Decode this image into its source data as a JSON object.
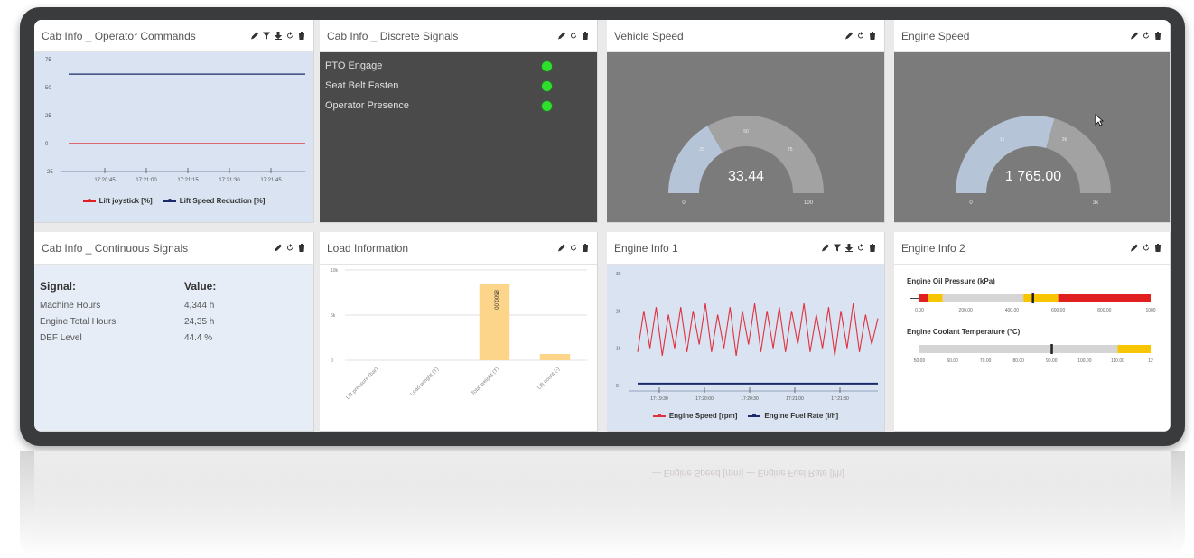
{
  "panels": {
    "operator_commands": {
      "title": "Cab Info _ Operator Commands",
      "chart_data": {
        "type": "line",
        "y_ticks": [
          "75",
          "50",
          "25",
          "0",
          "-25"
        ],
        "x_ticks": [
          "17:20:45",
          "17:21:00",
          "17:21:15",
          "17:21:30",
          "17:21:45"
        ],
        "ylim": [
          -25,
          75
        ],
        "series": [
          {
            "name": "Lift joystick [%]",
            "color": "#e02020",
            "values": [
              0,
              0,
              0,
              0,
              0,
              0
            ]
          },
          {
            "name": "Lift Speed Reduction [%]",
            "color": "#1a2a6a",
            "values": [
              62,
              62,
              62,
              62,
              62,
              62
            ]
          }
        ]
      }
    },
    "discrete_signals": {
      "title": "Cab Info _ Discrete Signals",
      "signals": [
        {
          "label": "PTO Engage",
          "state_color": "#2ce02c"
        },
        {
          "label": "Seat Belt Fasten",
          "state_color": "#2ce02c"
        },
        {
          "label": "Operator Presence",
          "state_color": "#2ce02c"
        }
      ]
    },
    "vehicle_speed": {
      "title": "Vehicle Speed",
      "value_text": "33.44",
      "value": 33.44,
      "min": 0,
      "max": 100,
      "min_label": "0",
      "max_label": "100",
      "ticks": [
        "25",
        "50",
        "75"
      ]
    },
    "engine_speed": {
      "title": "Engine Speed",
      "value_text": "1 765.00",
      "value": 1765,
      "min": 0,
      "max": 3000,
      "min_label": "0",
      "max_label": "3k",
      "ticks": [
        "1k",
        "2k"
      ]
    },
    "continuous_signals": {
      "title": "Cab Info _ Continuous Signals",
      "header_signal": "Signal:",
      "header_value": "Value:",
      "rows": [
        {
          "signal": "Machine Hours",
          "value": "4,344 h"
        },
        {
          "signal": "Engine Total Hours",
          "value": "24,35 h"
        },
        {
          "signal": "DEF Level",
          "value": "44.4 %"
        }
      ]
    },
    "load_information": {
      "title": "Load Information",
      "chart_data": {
        "type": "bar",
        "y_ticks": [
          "10k",
          "5k",
          "0"
        ],
        "ylim": [
          0,
          10000
        ],
        "categories": [
          "Lift pressure (bar)",
          "Load weight (T)",
          "Total weight (T)",
          "Lift count (-)"
        ],
        "values": [
          0,
          0,
          8500,
          700
        ],
        "bar_color": "#fcd58a",
        "data_label": "8500.00"
      }
    },
    "engine_info_1": {
      "title": "Engine Info 1",
      "chart_data": {
        "type": "line",
        "y_ticks": [
          "3k",
          "2k",
          "1k",
          "0"
        ],
        "x_ticks": [
          "17:19:30",
          "17:20:00",
          "17:20:30",
          "17:21:00",
          "17:21:30"
        ],
        "ylim": [
          0,
          3000
        ],
        "series": [
          {
            "name": "Engine Speed [rpm]",
            "color": "#e0313f",
            "values": [
              900,
              2000,
              1000,
              2100,
              800,
              1900,
              1000,
              2100,
              900,
              2000,
              1100,
              2200,
              900,
              1900,
              1000,
              2100,
              800,
              2000,
              1100,
              2200,
              900,
              2000,
              1000,
              2100,
              900,
              2000,
              1100,
              2200,
              900,
              1900,
              1000,
              2100,
              800,
              2000,
              1000,
              2200,
              900,
              1900,
              1100,
              1800
            ]
          },
          {
            "name": "Engine Fuel Rate [l/h]",
            "color": "#1a2a6a",
            "values": [
              50,
              50,
              50,
              50,
              50,
              50,
              50,
              50,
              50,
              50
            ]
          }
        ]
      }
    },
    "engine_info_2": {
      "title": "Engine Info 2",
      "gauges": [
        {
          "title": "Engine Oil Pressure (kPa)",
          "ticks": [
            "0.00",
            "200.00",
            "400.00",
            "600.00",
            "800.00",
            "1000"
          ],
          "min": 0,
          "max": 1000,
          "value": 490,
          "bands": [
            {
              "from": 0,
              "to": 40,
              "color": "#e02020"
            },
            {
              "from": 40,
              "to": 100,
              "color": "#f7c600"
            },
            {
              "from": 100,
              "to": 450,
              "color": "#d5d5d5"
            },
            {
              "from": 450,
              "to": 600,
              "color": "#f7c600"
            },
            {
              "from": 600,
              "to": 1000,
              "color": "#e02020"
            }
          ]
        },
        {
          "title": "Engine Coolant Temperature (°C)",
          "ticks": [
            "50.00",
            "60.00",
            "70.00",
            "80.00",
            "90.00",
            "100.00",
            "110.00",
            "12"
          ],
          "min": 50,
          "max": 120,
          "value": 90,
          "bands": [
            {
              "from": 50,
              "to": 110,
              "color": "#d5d5d5"
            },
            {
              "from": 110,
              "to": 120,
              "color": "#f7c600"
            }
          ]
        }
      ]
    }
  },
  "reflection_text": "— Engine Speed [rpm]   — Engine Fuel Rate [l/h]"
}
